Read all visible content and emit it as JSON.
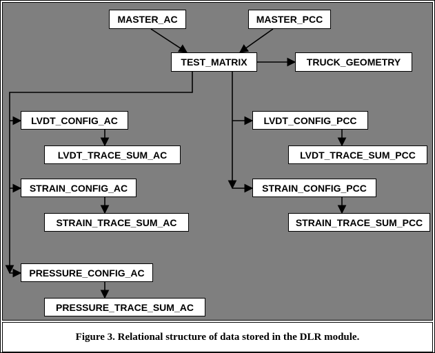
{
  "nodes": {
    "master_ac": "MASTER_AC",
    "master_pcc": "MASTER_PCC",
    "test_matrix": "TEST_MATRIX",
    "truck_geometry": "TRUCK_GEOMETRY",
    "lvdt_config_ac": "LVDT_CONFIG_AC",
    "lvdt_trace_sum_ac": "LVDT_TRACE_SUM_AC",
    "lvdt_config_pcc": "LVDT_CONFIG_PCC",
    "lvdt_trace_sum_pcc": "LVDT_TRACE_SUM_PCC",
    "strain_config_ac": "STRAIN_CONFIG_AC",
    "strain_trace_sum_ac": "STRAIN_TRACE_SUM_AC",
    "strain_config_pcc": "STRAIN_CONFIG_PCC",
    "strain_trace_sum_pcc": "STRAIN_TRACE_SUM_PCC",
    "pressure_config_ac": "PRESSURE_CONFIG_AC",
    "pressure_trace_sum_ac": "PRESSURE_TRACE_SUM_AC"
  },
  "caption": "Figure 3. Relational structure of data stored in the DLR module."
}
